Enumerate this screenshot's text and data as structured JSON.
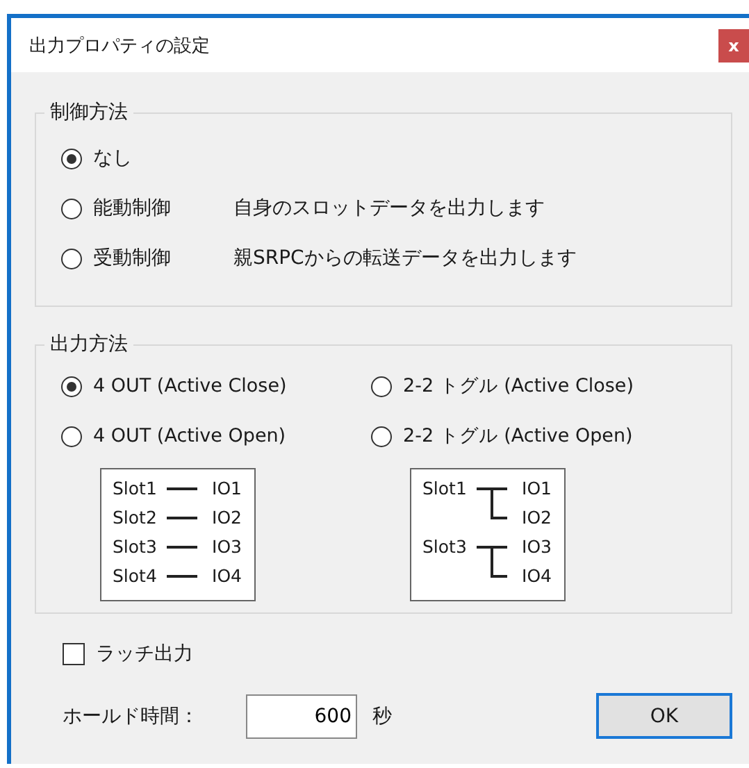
{
  "window": {
    "title": "出力プロパティの設定",
    "close": "x"
  },
  "control_method": {
    "legend": "制御方法",
    "options": [
      {
        "label": "なし",
        "selected": true
      },
      {
        "label": "能動制御",
        "selected": false,
        "description": "自身のスロットデータを出力します"
      },
      {
        "label": "受動制御",
        "selected": false,
        "description": "親SRPCからの転送データを出力します"
      }
    ]
  },
  "output_method": {
    "legend": "出力方法",
    "options": [
      {
        "label": "4 OUT (Active Close)",
        "selected": true
      },
      {
        "label": "2-2 トグル (Active Close)",
        "selected": false
      },
      {
        "label": "4 OUT (Active Open)",
        "selected": false
      },
      {
        "label": "2-2 トグル (Active Open)",
        "selected": false
      }
    ],
    "diagrams": [
      {
        "kind": "direct",
        "slots": [
          "Slot1",
          "Slot2",
          "Slot3",
          "Slot4"
        ],
        "outputs": [
          "IO1",
          "IO2",
          "IO3",
          "IO4"
        ]
      },
      {
        "kind": "toggle",
        "slots": [
          "Slot1",
          "Slot3"
        ],
        "outputs": [
          "IO1",
          "IO2",
          "IO3",
          "IO4"
        ]
      }
    ]
  },
  "latch": {
    "label": "ラッチ出力",
    "checked": false
  },
  "hold_time": {
    "label": "ホールド時間：",
    "value": "600",
    "unit": "秒"
  },
  "buttons": [
    "OK"
  ]
}
